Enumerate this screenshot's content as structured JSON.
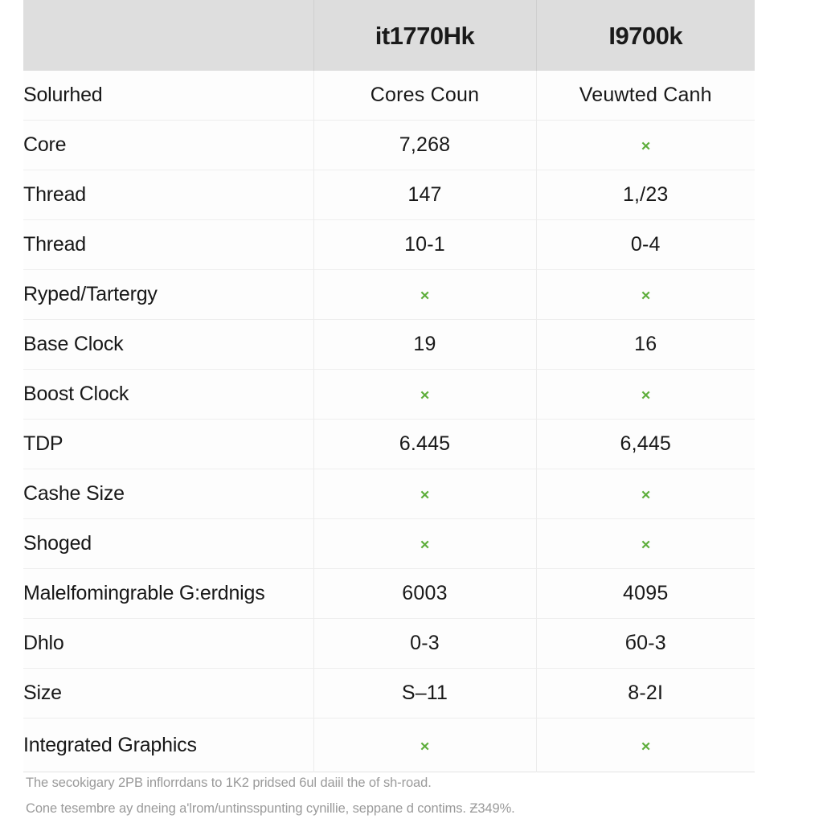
{
  "table": {
    "header": {
      "label_column": "",
      "columns": [
        "it1770Hk",
        "I9700k"
      ]
    },
    "rows": [
      {
        "label": "Solurhed",
        "values": [
          "Cores Coun",
          "Veuwted Canh"
        ]
      },
      {
        "label": "Core",
        "values": [
          "7,268",
          "check"
        ]
      },
      {
        "label": "Thread",
        "values": [
          "147",
          "1,/23"
        ]
      },
      {
        "label": "Thread",
        "values": [
          "10-1",
          "0-4"
        ]
      },
      {
        "label": "Ryped/Tartergy",
        "values": [
          "check",
          "check"
        ]
      },
      {
        "label": "Base Clock",
        "values": [
          "19",
          "16"
        ]
      },
      {
        "label": "Boost Clock",
        "values": [
          "check",
          "check"
        ]
      },
      {
        "label": "TDP",
        "values": [
          "6.445",
          "6,445"
        ]
      },
      {
        "label": "Cashe Size",
        "values": [
          "check",
          "check"
        ]
      },
      {
        "label": "Shoged",
        "values": [
          "check",
          "check"
        ]
      },
      {
        "label": "Malelfomingrable G:erdnigs",
        "values": [
          "6003",
          "4095"
        ]
      },
      {
        "label": "Dhlo",
        "values": [
          "0-3",
          "б0-3"
        ]
      },
      {
        "label": "Size",
        "values": [
          "S–11",
          "8-2I"
        ]
      },
      {
        "label": "Integrated Graphics",
        "values": [
          "check",
          "check"
        ]
      }
    ]
  },
  "footnotes": [
    "The secokigary 2PB inflorrdans to 1K2 pridsed 6ul daiil the of sh-road.",
    "Cone tesembre ay dneing a'lrom/untinsspunting cynillie, seppane d contims. Ƶ349%."
  ],
  "colors": {
    "check_green": "#5eae3c",
    "header_bg": "#dddddd",
    "text": "#181818",
    "footnote_text": "#9a9a9a"
  },
  "icons": {
    "check": "×"
  }
}
